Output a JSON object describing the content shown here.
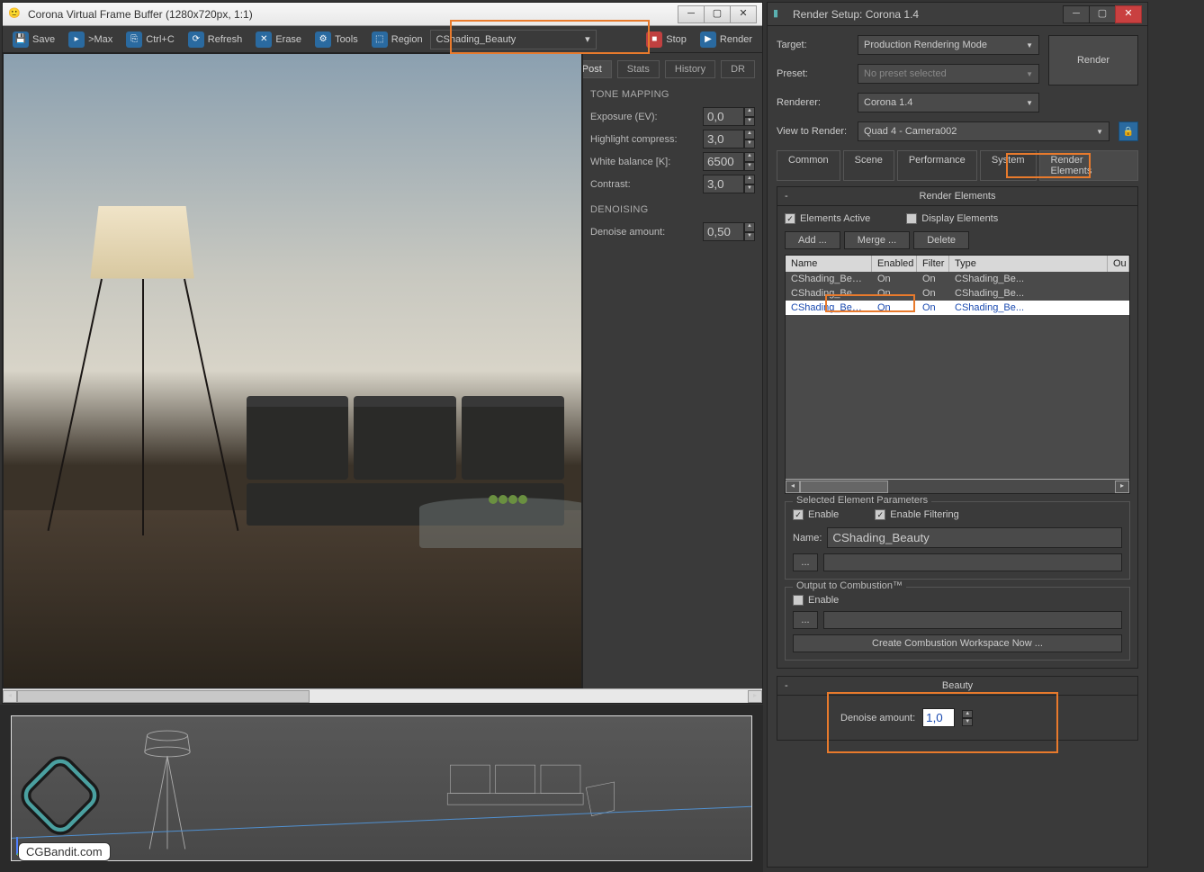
{
  "vfb": {
    "title": "Corona Virtual Frame Buffer (1280x720px, 1:1)",
    "toolbar": {
      "save": "Save",
      "max": ">Max",
      "ctrlc": "Ctrl+C",
      "refresh": "Refresh",
      "erase": "Erase",
      "tools": "Tools",
      "region": "Region",
      "element_selected": "CShading_Beauty",
      "stop": "Stop",
      "render": "Render"
    },
    "side_tabs": {
      "post": "Post",
      "stats": "Stats",
      "history": "History",
      "dr": "DR"
    },
    "tone_mapping": {
      "title": "TONE MAPPING",
      "exposure_label": "Exposure (EV):",
      "exposure_val": "0,0",
      "highlight_label": "Highlight compress:",
      "highlight_val": "3,0",
      "wb_label": "White balance [K]:",
      "wb_val": "6500",
      "contrast_label": "Contrast:",
      "contrast_val": "3,0"
    },
    "denoising": {
      "title": "DENOISING",
      "amount_label": "Denoise amount:",
      "amount_val": "0,50"
    }
  },
  "rs": {
    "title": "Render Setup: Corona 1.4",
    "target_label": "Target:",
    "target_val": "Production Rendering Mode",
    "preset_label": "Preset:",
    "preset_val": "No preset selected",
    "renderer_label": "Renderer:",
    "renderer_val": "Corona 1.4",
    "view_label": "View to Render:",
    "view_val": "Quad 4 - Camera002",
    "render_btn": "Render",
    "tabs": {
      "common": "Common",
      "scene": "Scene",
      "performance": "Performance",
      "system": "System",
      "elements": "Render Elements"
    },
    "rollout_elements": "Render Elements",
    "elements_active": "Elements Active",
    "display_elements": "Display Elements",
    "btn_add": "Add ...",
    "btn_merge": "Merge ...",
    "btn_delete": "Delete",
    "cols": {
      "name": "Name",
      "enabled": "Enabled",
      "filter": "Filter",
      "type": "Type",
      "out": "Ou"
    },
    "rows": [
      {
        "name": "CShading_Beauty",
        "enabled": "On",
        "filter": "On",
        "type": "CShading_Be..."
      },
      {
        "name": "CShading_Beauty",
        "enabled": "On",
        "filter": "On",
        "type": "CShading_Be..."
      },
      {
        "name": "CShading_Beauty",
        "enabled": "On",
        "filter": "On",
        "type": "CShading_Be...",
        "selected": true
      }
    ],
    "sel_params": {
      "legend": "Selected Element Parameters",
      "enable": "Enable",
      "enable_filter": "Enable Filtering",
      "name_label": "Name:",
      "name_val": "CShading_Beauty"
    },
    "combustion": {
      "legend": "Output to Combustion™",
      "enable": "Enable",
      "create_btn": "Create Combustion Workspace Now ..."
    },
    "beauty": {
      "title": "Beauty",
      "denoise_label": "Denoise amount:",
      "denoise_val": "1,0"
    }
  },
  "logo_text": "CGBandit.com"
}
